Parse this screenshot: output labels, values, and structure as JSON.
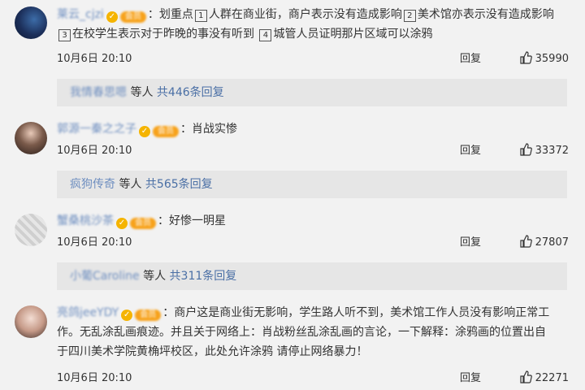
{
  "comments": [
    {
      "username": "莱云_cjzi",
      "vip": "会员",
      "segments": [
        "：划重点",
        "人群在商业街，商户表示没有造成影响",
        "美术馆亦表示没有造成影响",
        "在校学生表示对于昨晚的事没有听到",
        "城管人员证明那片区域可以涂鸦"
      ],
      "nums": [
        "1",
        "2",
        "3",
        "4"
      ],
      "date": "10月6日 20:10",
      "reply": "回复",
      "likes": "35990",
      "replies": {
        "who": "我情春思嗯",
        "suffix": "等人",
        "total": "共446条回复"
      }
    },
    {
      "username": "郭源一秦之之子",
      "vip": "会员",
      "text": "：肖战实惨",
      "date": "10月6日 20:10",
      "reply": "回复",
      "likes": "33372",
      "replies": {
        "who": "疯狗传奇",
        "suffix": "等人",
        "total": "共565条回复"
      }
    },
    {
      "username": "蟹桑桃沙茶",
      "vip": "会员",
      "text": "：好惨一明星",
      "date": "10月6日 20:10",
      "reply": "回复",
      "likes": "27807",
      "replies": {
        "who": "小葡Caroline",
        "suffix": "等人",
        "total": "共311条回复"
      }
    },
    {
      "username": "亮鸽jeeYDY",
      "vip": "会员",
      "line1": "：商户这是商业街无影响，学生路人听不到，美术馆工作人员没有影响正常工",
      "line2": "作。无乱涂乱画痕迹。并且关于网络上：肖战粉丝乱涂乱画的言论，一下解释：涂鸦画的位置出自",
      "line3": "于四川美术学院黄桷坪校区，此处允许涂鸦 请停止网络暴力！",
      "date": "10月6日 20:10",
      "reply": "回复",
      "likes": "22271"
    }
  ],
  "icons": {
    "like": "thumbs-up-icon",
    "verified": "verified-badge-icon"
  },
  "colors": {
    "link": "#6f8fc0",
    "total": "#4a6fa5",
    "vip": "#f7a21b",
    "badge": "#f5b400"
  }
}
